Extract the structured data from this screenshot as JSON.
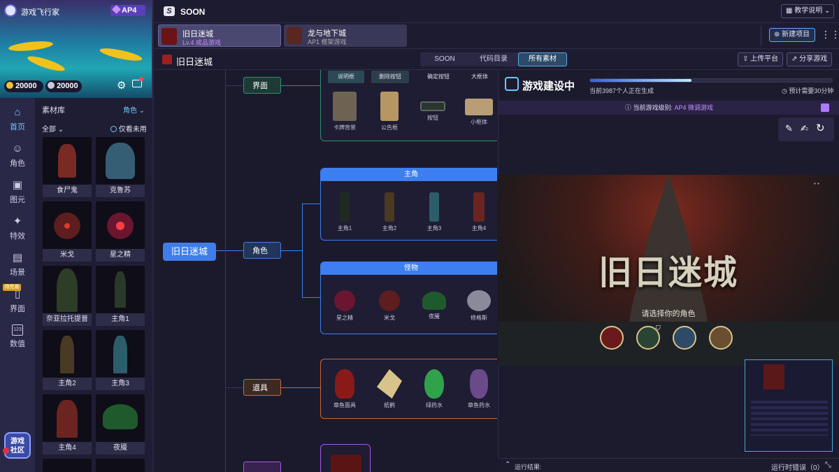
{
  "profile": {
    "name": "游戏飞行家",
    "tier": "AP4",
    "coins_gold": "20000",
    "coins_silver": "20000"
  },
  "nav": [
    {
      "label": "首页",
      "icon": "home-icon",
      "active": true
    },
    {
      "label": "角色",
      "icon": "character-icon"
    },
    {
      "label": "图元",
      "icon": "image-icon"
    },
    {
      "label": "特效",
      "icon": "sparkle-icon"
    },
    {
      "label": "场景",
      "icon": "map-icon"
    },
    {
      "label": "界面",
      "icon": "interface-icon",
      "badge": "待完善"
    },
    {
      "label": "数值",
      "icon": "number-icon",
      "icon_text": "123"
    }
  ],
  "community": "游戏社区",
  "library": {
    "title": "素材库",
    "filter_type": "角色",
    "filter_all": "全部",
    "only_used": "仅看未用",
    "items": [
      "食尸鬼",
      "克鲁苏",
      "米戈",
      "星之精",
      "奈亚拉托提普",
      "主角1",
      "主角2",
      "主角3",
      "主角4",
      "夜魇"
    ]
  },
  "topbar": {
    "logo_text": "SOON",
    "tutorial": "教学说明"
  },
  "project_tabs": [
    {
      "title": "旧日迷城",
      "sub": "Lv.4 成品游戏",
      "active": true
    },
    {
      "title": "龙与地下城",
      "sub": "AP1 框架游戏",
      "active": false
    }
  ],
  "new_project": "新建项目",
  "subbar": {
    "project_name": "旧日迷城",
    "tabs": [
      "SOON",
      "代码目录",
      "所有素材"
    ],
    "active_tab": "所有素材",
    "upload": "上传平台",
    "share": "分享游戏"
  },
  "tree": {
    "root": "旧日迷城",
    "branches": [
      "界面",
      "角色",
      "道具"
    ],
    "ui_buttons": [
      "说明框",
      "删除按钮",
      "确定按钮",
      "大框体"
    ],
    "ui_items": [
      "卡牌背景",
      "公告框",
      "按钮",
      "小框体"
    ],
    "protag_head": "主角",
    "protags": [
      "主角1",
      "主角2",
      "主角3",
      "主角4"
    ],
    "monster_head": "怪物",
    "monsters": [
      "星之精",
      "米戈",
      "夜魇",
      "修格斯"
    ],
    "props": [
      "章鱼面具",
      "纸鹤",
      "绿药水",
      "章鱼药水"
    ]
  },
  "build": {
    "title": "游戏建设中",
    "progress": 0.42,
    "users_text": "当前3987个人正在生成",
    "eta": "预计需要30分钟",
    "level_prefix": "当前游戏级别:",
    "level_value": "AP4 微调游戏"
  },
  "game": {
    "title": "旧日迷城",
    "prompt": "请选择你的角色"
  },
  "console": {
    "result_label": "运行结果:",
    "errors": "运行时错误（0）"
  }
}
